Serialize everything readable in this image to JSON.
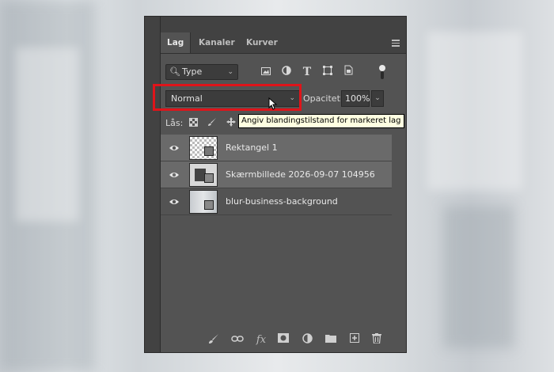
{
  "panel": {
    "tabs": [
      {
        "label": "Lag",
        "active": true
      },
      {
        "label": "Kanaler",
        "active": false
      },
      {
        "label": "Kurver",
        "active": false
      }
    ],
    "menu_icon": "hamburger-menu-icon"
  },
  "filter": {
    "selected": "Type",
    "icons": [
      "image-filter-icon",
      "adjustment-filter-icon",
      "type-filter-icon",
      "shape-filter-icon",
      "smart-object-filter-icon"
    ]
  },
  "blend_mode": {
    "value": "Normal",
    "highlight_color": "#e0141a"
  },
  "opacity": {
    "label": "Opacitet:",
    "value": "100%"
  },
  "lock": {
    "label": "Lås:",
    "icons": [
      "lock-transparent-icon",
      "lock-paint-icon",
      "lock-move-icon"
    ]
  },
  "tooltip": "Angiv blandingstilstand for markeret lag",
  "layers": [
    {
      "name": "Rektangel 1",
      "visible": true,
      "selected": true
    },
    {
      "name": "Skærmbillede 2026-09-07 104956",
      "visible": true,
      "selected": true
    },
    {
      "name": "blur-business-background",
      "visible": true,
      "selected": false
    }
  ],
  "footer_icons": [
    "brush-icon",
    "link-icon",
    "fx-icon",
    "mask-icon",
    "adjustment-icon",
    "folder-icon",
    "new-layer-icon",
    "trash-icon"
  ],
  "colors": {
    "panel": "#535353",
    "panel_dark": "#424242",
    "selected_row": "#6a6a6a",
    "tooltip_bg": "#ffffe1"
  }
}
